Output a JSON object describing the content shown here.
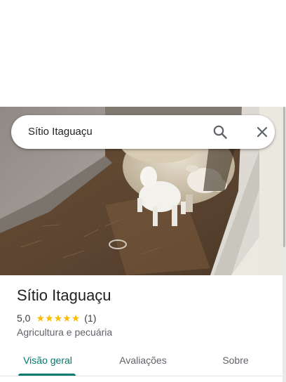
{
  "search": {
    "value": "Sítio Itaguaçu",
    "search_icon": "search-icon",
    "close_icon": "close-icon"
  },
  "hero": {
    "image": "photo-sheep-with-lamb"
  },
  "place": {
    "name": "Sítio Itaguaçu",
    "rating": "5,0",
    "stars": 5,
    "review_count": "(1)",
    "category": "Agricultura e pecuária"
  },
  "tabs": [
    {
      "label": "Visão geral",
      "active": true
    },
    {
      "label": "Avaliações",
      "active": false
    },
    {
      "label": "Sobre",
      "active": false
    }
  ],
  "colors": {
    "accent": "#01796f",
    "star": "#fbbc04",
    "text_primary": "#202124",
    "text_secondary": "#5f6368"
  }
}
